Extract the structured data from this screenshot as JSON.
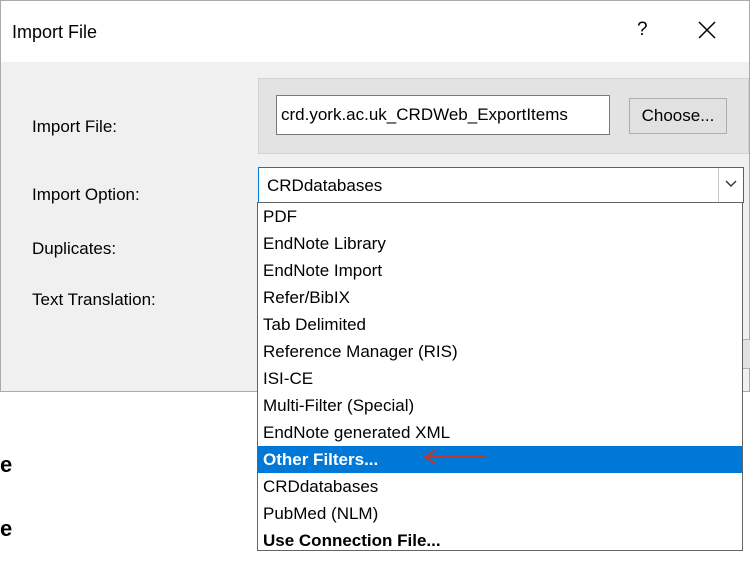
{
  "dialog": {
    "title": "Import File",
    "help_label": "?",
    "close_icon": "close-icon"
  },
  "form": {
    "import_file_label": "Import File:",
    "import_file_value": "crd.york.ac.uk_CRDWeb_ExportItems",
    "choose_label": "Choose...",
    "import_option_label": "Import Option:",
    "import_option_value": "CRDdatabases",
    "duplicates_label": "Duplicates:",
    "text_translation_label": "Text Translation:"
  },
  "dropdown": {
    "options": [
      {
        "label": "PDF"
      },
      {
        "label": "EndNote Library"
      },
      {
        "label": "EndNote Import"
      },
      {
        "label": "Refer/BibIX"
      },
      {
        "label": "Tab Delimited"
      },
      {
        "label": "Reference Manager (RIS)"
      },
      {
        "label": "ISI-CE"
      },
      {
        "label": "Multi-Filter (Special)"
      },
      {
        "label": "EndNote generated XML"
      },
      {
        "label": "Other Filters...",
        "highlighted": true
      },
      {
        "label": "CRDdatabases"
      },
      {
        "label": "PubMed (NLM)"
      },
      {
        "label": "Use Connection File...",
        "bold": true
      }
    ]
  },
  "annotation": {
    "arrow_color": "#c0392b"
  },
  "background": {
    "glyphs": [
      "e",
      "e"
    ]
  },
  "colors": {
    "selection": "#0078d7",
    "dialog_bg": "#f0f0f0"
  }
}
